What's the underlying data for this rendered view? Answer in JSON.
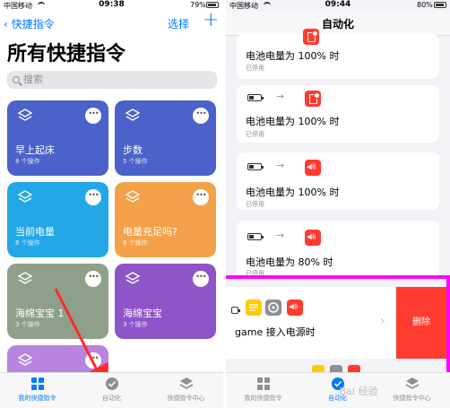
{
  "left": {
    "status": {
      "carrier": "中国移动",
      "time": "09:38",
      "battery": "79%"
    },
    "nav": {
      "back_label": "快捷指令",
      "select_label": "选择",
      "add_label": "+"
    },
    "title": "所有快捷指令",
    "search_placeholder": "搜索",
    "cards": [
      {
        "title": "早上起床",
        "sub": "8 个操作",
        "color": "#4a62c9"
      },
      {
        "title": "步数",
        "sub": "5 个操作",
        "color": "#4a62c9"
      },
      {
        "title": "当前电量",
        "sub": "8 个操作",
        "color": "#23a7e6"
      },
      {
        "title": "电量充足吗?",
        "sub": "8 个操作",
        "color": "#f4a14a"
      },
      {
        "title": "海绵宝宝 1",
        "sub": "3 个操作",
        "color": "#8fa08a"
      },
      {
        "title": "海绵宝宝",
        "sub": "3 个操作",
        "color": "#8d55c8"
      },
      {
        "title": "",
        "sub": "",
        "color": "#b884e0"
      }
    ],
    "tabs": [
      "我的快捷指令",
      "自动化",
      "快捷指令中心"
    ]
  },
  "right": {
    "status": {
      "carrier": "中国移动",
      "time": "09:44",
      "battery": "80%"
    },
    "title": "自动化",
    "items": [
      {
        "label": "电池电量为 100% 时",
        "status": "已停用"
      },
      {
        "label": "电池电量为 100% 时",
        "status": "已停用"
      },
      {
        "label": "电池电量为 100% 时",
        "status": "已停用"
      },
      {
        "label": "电池电量为 80% 时",
        "status": "已停用"
      }
    ],
    "game_label": "game 接入电源时",
    "delete_label": "删除",
    "tabs": [
      "我的快捷指令",
      "自动化",
      "快捷指令中心"
    ],
    "watermark": "Bai 经验"
  },
  "colors": {
    "accent": "#007aff",
    "highlight": "#ff00ff",
    "danger": "#ff3b30"
  }
}
